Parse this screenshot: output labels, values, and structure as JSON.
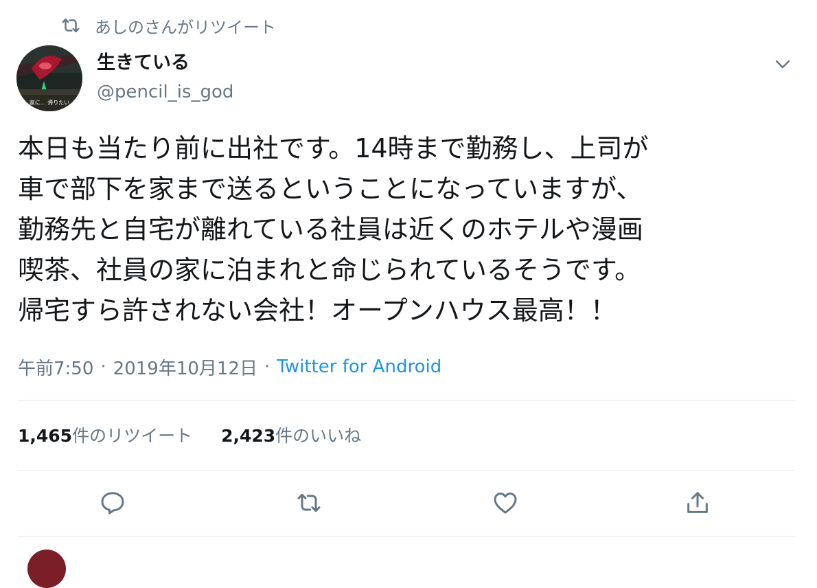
{
  "retweet_context": {
    "icon": "retweet-icon",
    "text": "あしのさんがリツイート"
  },
  "author": {
    "display_name": "生きている",
    "screen_name": "@pencil_is_god",
    "avatar_caption": "家に…  帰りたい"
  },
  "tweet": {
    "text": "本日も当たり前に出社です。14時まで勤務し、上司が\n車で部下を家まで送るということになっていますが、\n勤務先と自宅が離れている社員は近くのホテルや漫画\n喫茶、社員の家に泊まれと命じられているそうです。\n帰宅すら許されない会社！オープンハウス最高！！"
  },
  "meta": {
    "time": "午前7:50",
    "separator": "·",
    "date": "2019年10月12日",
    "source": "Twitter for Android"
  },
  "counts": {
    "retweets": {
      "number": "1,465",
      "label": "件のリツイート"
    },
    "likes": {
      "number": "2,423",
      "label": "件のいいね"
    }
  },
  "actions": [
    {
      "icon": "reply-icon"
    },
    {
      "icon": "retweet-icon"
    },
    {
      "icon": "like-heart-icon"
    },
    {
      "icon": "share-icon"
    }
  ],
  "colors": {
    "text": "#14171a",
    "secondary": "#657786",
    "link": "#1b95e0",
    "divider": "#e1e8ed"
  }
}
